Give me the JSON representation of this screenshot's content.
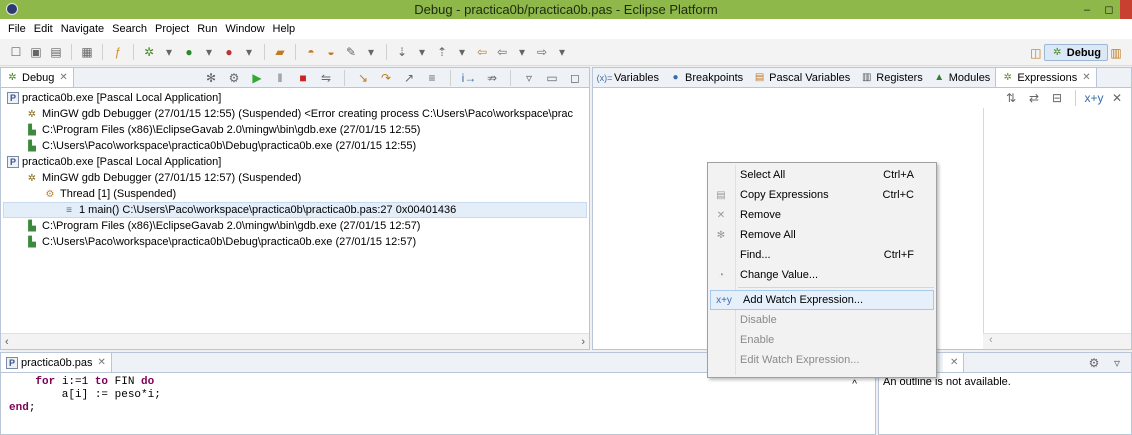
{
  "window": {
    "title": "Debug - practica0b/practica0b.pas - Eclipse Platform",
    "min": "–",
    "max": "◻"
  },
  "menu": [
    "File",
    "Edit",
    "Navigate",
    "Search",
    "Project",
    "Run",
    "Window",
    "Help"
  ],
  "perspective": {
    "label": "Debug"
  },
  "debug_view": {
    "tab": "Debug",
    "rows": [
      {
        "icon": "launch",
        "indent": 0,
        "text": "practica0b.exe [Pascal Local Application]"
      },
      {
        "icon": "debugger",
        "indent": 1,
        "text": "MinGW gdb Debugger (27/01/15 12:55) (Suspended) <Error creating process C:\\Users\\Paco\\workspace\\prac"
      },
      {
        "icon": "process",
        "indent": 1,
        "text": "C:\\Program Files (x86)\\EclipseGavab 2.0\\mingw\\bin\\gdb.exe (27/01/15 12:55)"
      },
      {
        "icon": "process",
        "indent": 1,
        "text": "C:\\Users\\Paco\\workspace\\practica0b\\Debug\\practica0b.exe (27/01/15 12:55)"
      },
      {
        "icon": "launch",
        "indent": 0,
        "text": "practica0b.exe [Pascal Local Application]"
      },
      {
        "icon": "debugger",
        "indent": 1,
        "text": "MinGW gdb Debugger (27/01/15 12:57) (Suspended)"
      },
      {
        "icon": "thread",
        "indent": 2,
        "text": "Thread [1] (Suspended)"
      },
      {
        "icon": "frame",
        "indent": 3,
        "text": "1 main() C:\\Users\\Paco\\workspace\\practica0b\\practica0b.pas:27 0x00401436",
        "selected": true
      },
      {
        "icon": "process",
        "indent": 1,
        "text": "C:\\Program Files (x86)\\EclipseGavab 2.0\\mingw\\bin\\gdb.exe (27/01/15 12:57)"
      },
      {
        "icon": "process",
        "indent": 1,
        "text": "C:\\Users\\Paco\\workspace\\practica0b\\Debug\\practica0b.exe (27/01/15 12:57)"
      }
    ]
  },
  "right_tabs": [
    "Variables",
    "Breakpoints",
    "Pascal Variables",
    "Registers",
    "Modules",
    "Expressions"
  ],
  "editor": {
    "tab": "practica0b.pas",
    "lines": [
      "    for i:=1 to FIN do",
      "        a[i] := peso*i;",
      "end;"
    ]
  },
  "outline": {
    "tab_close": "☒",
    "message": "An outline is not available."
  },
  "context_menu": [
    {
      "label": "Select All",
      "accel": "Ctrl+A",
      "enabled": true
    },
    {
      "label": "Copy Expressions",
      "accel": "Ctrl+C",
      "enabled": true,
      "icon": "copy-icon"
    },
    {
      "label": "Remove",
      "accel": "",
      "enabled": true,
      "icon": "remove-icon"
    },
    {
      "label": "Remove All",
      "accel": "",
      "enabled": true,
      "icon": "remove-all-icon"
    },
    {
      "label": "Find...",
      "accel": "Ctrl+F",
      "enabled": true
    },
    {
      "label": "Change Value...",
      "accel": "",
      "enabled": true,
      "icon": "change-value-icon"
    },
    {
      "sep": true
    },
    {
      "label": "Add Watch Expression...",
      "accel": "",
      "enabled": true,
      "highlighted": true,
      "icon": "watch-icon"
    },
    {
      "label": "Disable",
      "accel": "",
      "enabled": false
    },
    {
      "label": "Enable",
      "accel": "",
      "enabled": false
    },
    {
      "label": "Edit Watch Expression...",
      "accel": "",
      "enabled": false
    }
  ]
}
